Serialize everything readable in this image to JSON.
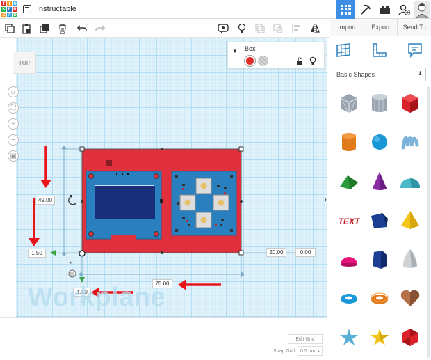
{
  "app": {
    "title": "Instructable",
    "logo_letters": [
      "T",
      "I",
      "N",
      "K",
      "E",
      "R",
      "C",
      "A",
      "D"
    ],
    "logo_colors": [
      "#e02f2f",
      "#f89a1c",
      "#27a3dc",
      "#29b34a",
      "#2b74c8",
      "#e02f2f",
      "#f89a1c",
      "#27a3dc",
      "#29b34a"
    ]
  },
  "topbar_icons": [
    "grid-view-icon",
    "pickaxe-icon",
    "bricks-icon",
    "add-user-icon",
    "user-avatar"
  ],
  "toolbar": {
    "left_icons": [
      "copy-icon",
      "paste-icon",
      "duplicate-icon",
      "delete-icon",
      "undo-icon",
      "redo-icon"
    ],
    "right_icons": [
      "note-icon",
      "light-bulb-icon",
      "group-icon",
      "ungroup-icon",
      "align-icon",
      "mirror-icon"
    ]
  },
  "right_panel": {
    "tabs": [
      "Import",
      "Export",
      "Send To"
    ],
    "mode_icons": [
      "workplane-icon",
      "ruler-icon",
      "notes-icon"
    ],
    "shape_category": "Basic Shapes",
    "shapes": [
      {
        "name": "box-striped",
        "color": "#9aa4b0"
      },
      {
        "name": "cylinder-striped",
        "color": "#9aa4b0"
      },
      {
        "name": "box",
        "color": "#d9222a"
      },
      {
        "name": "cylinder",
        "color": "#e07a1b"
      },
      {
        "name": "sphere",
        "color": "#1a98d5"
      },
      {
        "name": "scribble",
        "color": "#7db3d8"
      },
      {
        "name": "roof",
        "color": "#2d9b3c"
      },
      {
        "name": "cone",
        "color": "#8a2ba3"
      },
      {
        "name": "round-roof",
        "color": "#4ab8c8"
      },
      {
        "name": "text",
        "color": "#c8161e"
      },
      {
        "name": "polygon",
        "color": "#1c3f94"
      },
      {
        "name": "pyramid",
        "color": "#f3c514"
      },
      {
        "name": "half-sphere",
        "color": "#e5147a"
      },
      {
        "name": "polygon-prism",
        "color": "#1c3f94"
      },
      {
        "name": "paraboloid",
        "color": "#cfd3d6"
      },
      {
        "name": "torus",
        "color": "#1a98d5"
      },
      {
        "name": "tube",
        "color": "#e07a1b"
      },
      {
        "name": "heart",
        "color": "#b5724a"
      },
      {
        "name": "star",
        "color": "#5ab0d6"
      },
      {
        "name": "star-gold",
        "color": "#f0c419"
      },
      {
        "name": "icosahedron",
        "color": "#d9222a"
      }
    ]
  },
  "canvas": {
    "view_cube_label": "TOP",
    "nav_icons": [
      "home-icon",
      "fit-icon",
      "zoom-in-icon",
      "zoom-out-icon",
      "ortho-icon"
    ],
    "workplane_label": "Workplane",
    "selected_shape": {
      "name": "Box",
      "colors": [
        "#e02b2b",
        "solid",
        "hole"
      ]
    },
    "dimensions": {
      "height": "49.00",
      "width": "75.00",
      "left_offset": "1.50",
      "bottom_offset": "1.50",
      "right_offset": "20.00",
      "right_z": "0.00"
    },
    "edit_grid_label": "Edit Grid",
    "snap_grid_label": "Snap Grid",
    "snap_grid_value": "0.5 mm"
  },
  "colors": {
    "accent": "#3d8ee6",
    "grid_bg": "#dff2fb",
    "grid_line": "#9ed3ee",
    "box_red": "#e0303e",
    "pcb_blue": "#2a7fbf",
    "annotation_red": "#e8141a"
  }
}
